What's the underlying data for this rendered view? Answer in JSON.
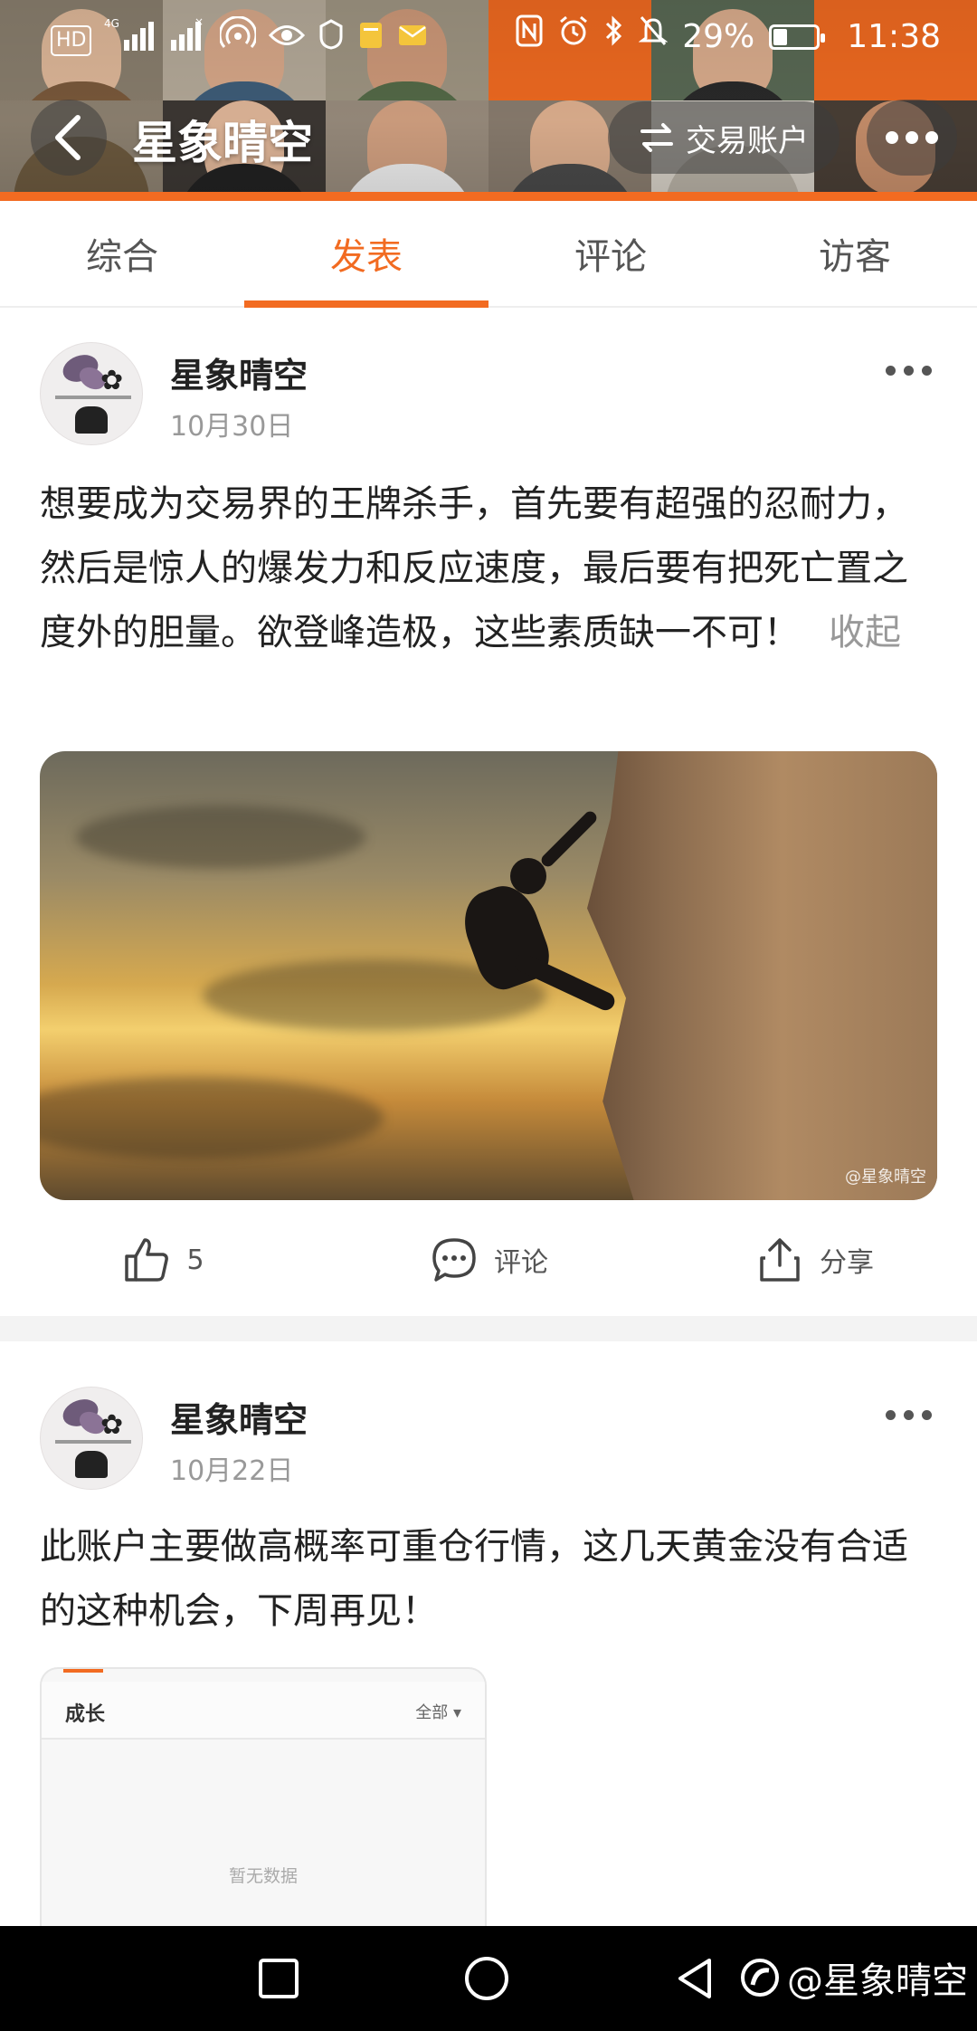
{
  "status_bar": {
    "left_icons": [
      "hd-icon",
      "signal-4g-icon",
      "signal-x-icon",
      "hotspot-icon",
      "eye-icon",
      "shield-icon",
      "file-icon",
      "mail-icon"
    ],
    "network_label": "4G",
    "battery_percent": "29%",
    "battery_level": 0.29,
    "time": "11:38"
  },
  "header": {
    "title": "星象晴空",
    "account_button_label": "交易账户",
    "accent_color": "#f26b21"
  },
  "tabs": [
    {
      "label": "综合",
      "active": false
    },
    {
      "label": "发表",
      "active": true
    },
    {
      "label": "评论",
      "active": false
    },
    {
      "label": "访客",
      "active": false
    }
  ],
  "posts": [
    {
      "author": "星象晴空",
      "date": "10月30日",
      "text": "想要成为交易界的王牌杀手，首先要有超强的忍耐力，然后是惊人的爆发力和反应速度，最后要有把死亡置之度外的胆量。欲登峰造极，这些素质缺一不可！",
      "collapse_label": "收起",
      "image_watermark": "@星象晴空",
      "like_count": "5",
      "comment_label": "评论",
      "share_label": "分享"
    },
    {
      "author": "星象晴空",
      "date": "10月22日",
      "text": "此账户主要做高概率可重仓行情，这几天黄金没有合适的这种机会，下周再见！",
      "screenshot": {
        "title": "成长",
        "filter": "全部",
        "empty": "暂无数据"
      }
    }
  ],
  "nav_bar": {
    "watermark": "@星象晴空"
  }
}
